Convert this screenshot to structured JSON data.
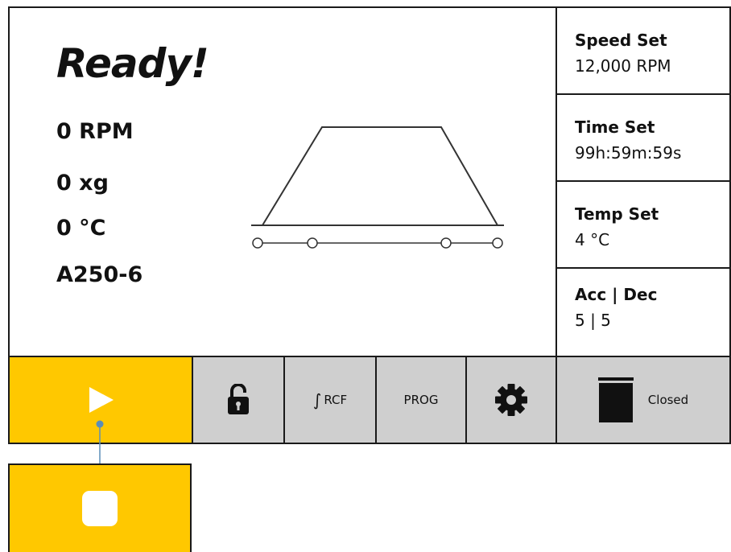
{
  "status": {
    "title": "Ready!"
  },
  "readings": {
    "speed": "0 RPM",
    "rcf": "0 xg",
    "temperature": "0 °C",
    "rotor": "A250-6"
  },
  "settings": [
    {
      "label": "Speed Set",
      "value": "12,000 RPM"
    },
    {
      "label": "Time Set",
      "value": "99h:59m:59s"
    },
    {
      "label": "Temp Set",
      "value": "4 °C"
    },
    {
      "label": "Acc | Dec",
      "value": "5 | 5"
    }
  ],
  "toolbar": {
    "rcf_label": "RCF",
    "prog_label": "PROG",
    "lid_status": "Closed"
  },
  "colors": {
    "accent_yellow": "#ffc800",
    "toolbar_gray": "#cfcfcf",
    "connector_blue": "#5b8db8"
  },
  "icons": [
    "play-icon",
    "unlock-icon",
    "integral-icon",
    "gear-icon",
    "lid-icon",
    "stop-icon"
  ]
}
